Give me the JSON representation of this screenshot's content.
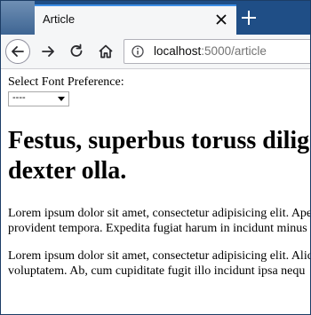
{
  "browser": {
    "tab_title": "Article",
    "url_host": "localhost",
    "url_path": ":5000/article"
  },
  "page": {
    "font_label": "Select Font Preference:",
    "font_select_value": "----",
    "heading": "Festus, superbus toruss diligenter dexter olla.",
    "paragraphs": [
      "Lorem ipsum dolor sit amet, consectetur adipisicing elit. Aperiam provident tempora. Expedita fugiat harum in incidunt minus",
      "Lorem ipsum dolor sit amet, consectetur adipisicing elit. Aliquam voluptatem. Ab, cum cupiditate fugit illo incidunt ipsa nequ"
    ]
  },
  "colors": {
    "tab_strip": "#1f4e86",
    "tab_accent": "#3d8fe6",
    "toolbar": "#f5f6f7"
  }
}
